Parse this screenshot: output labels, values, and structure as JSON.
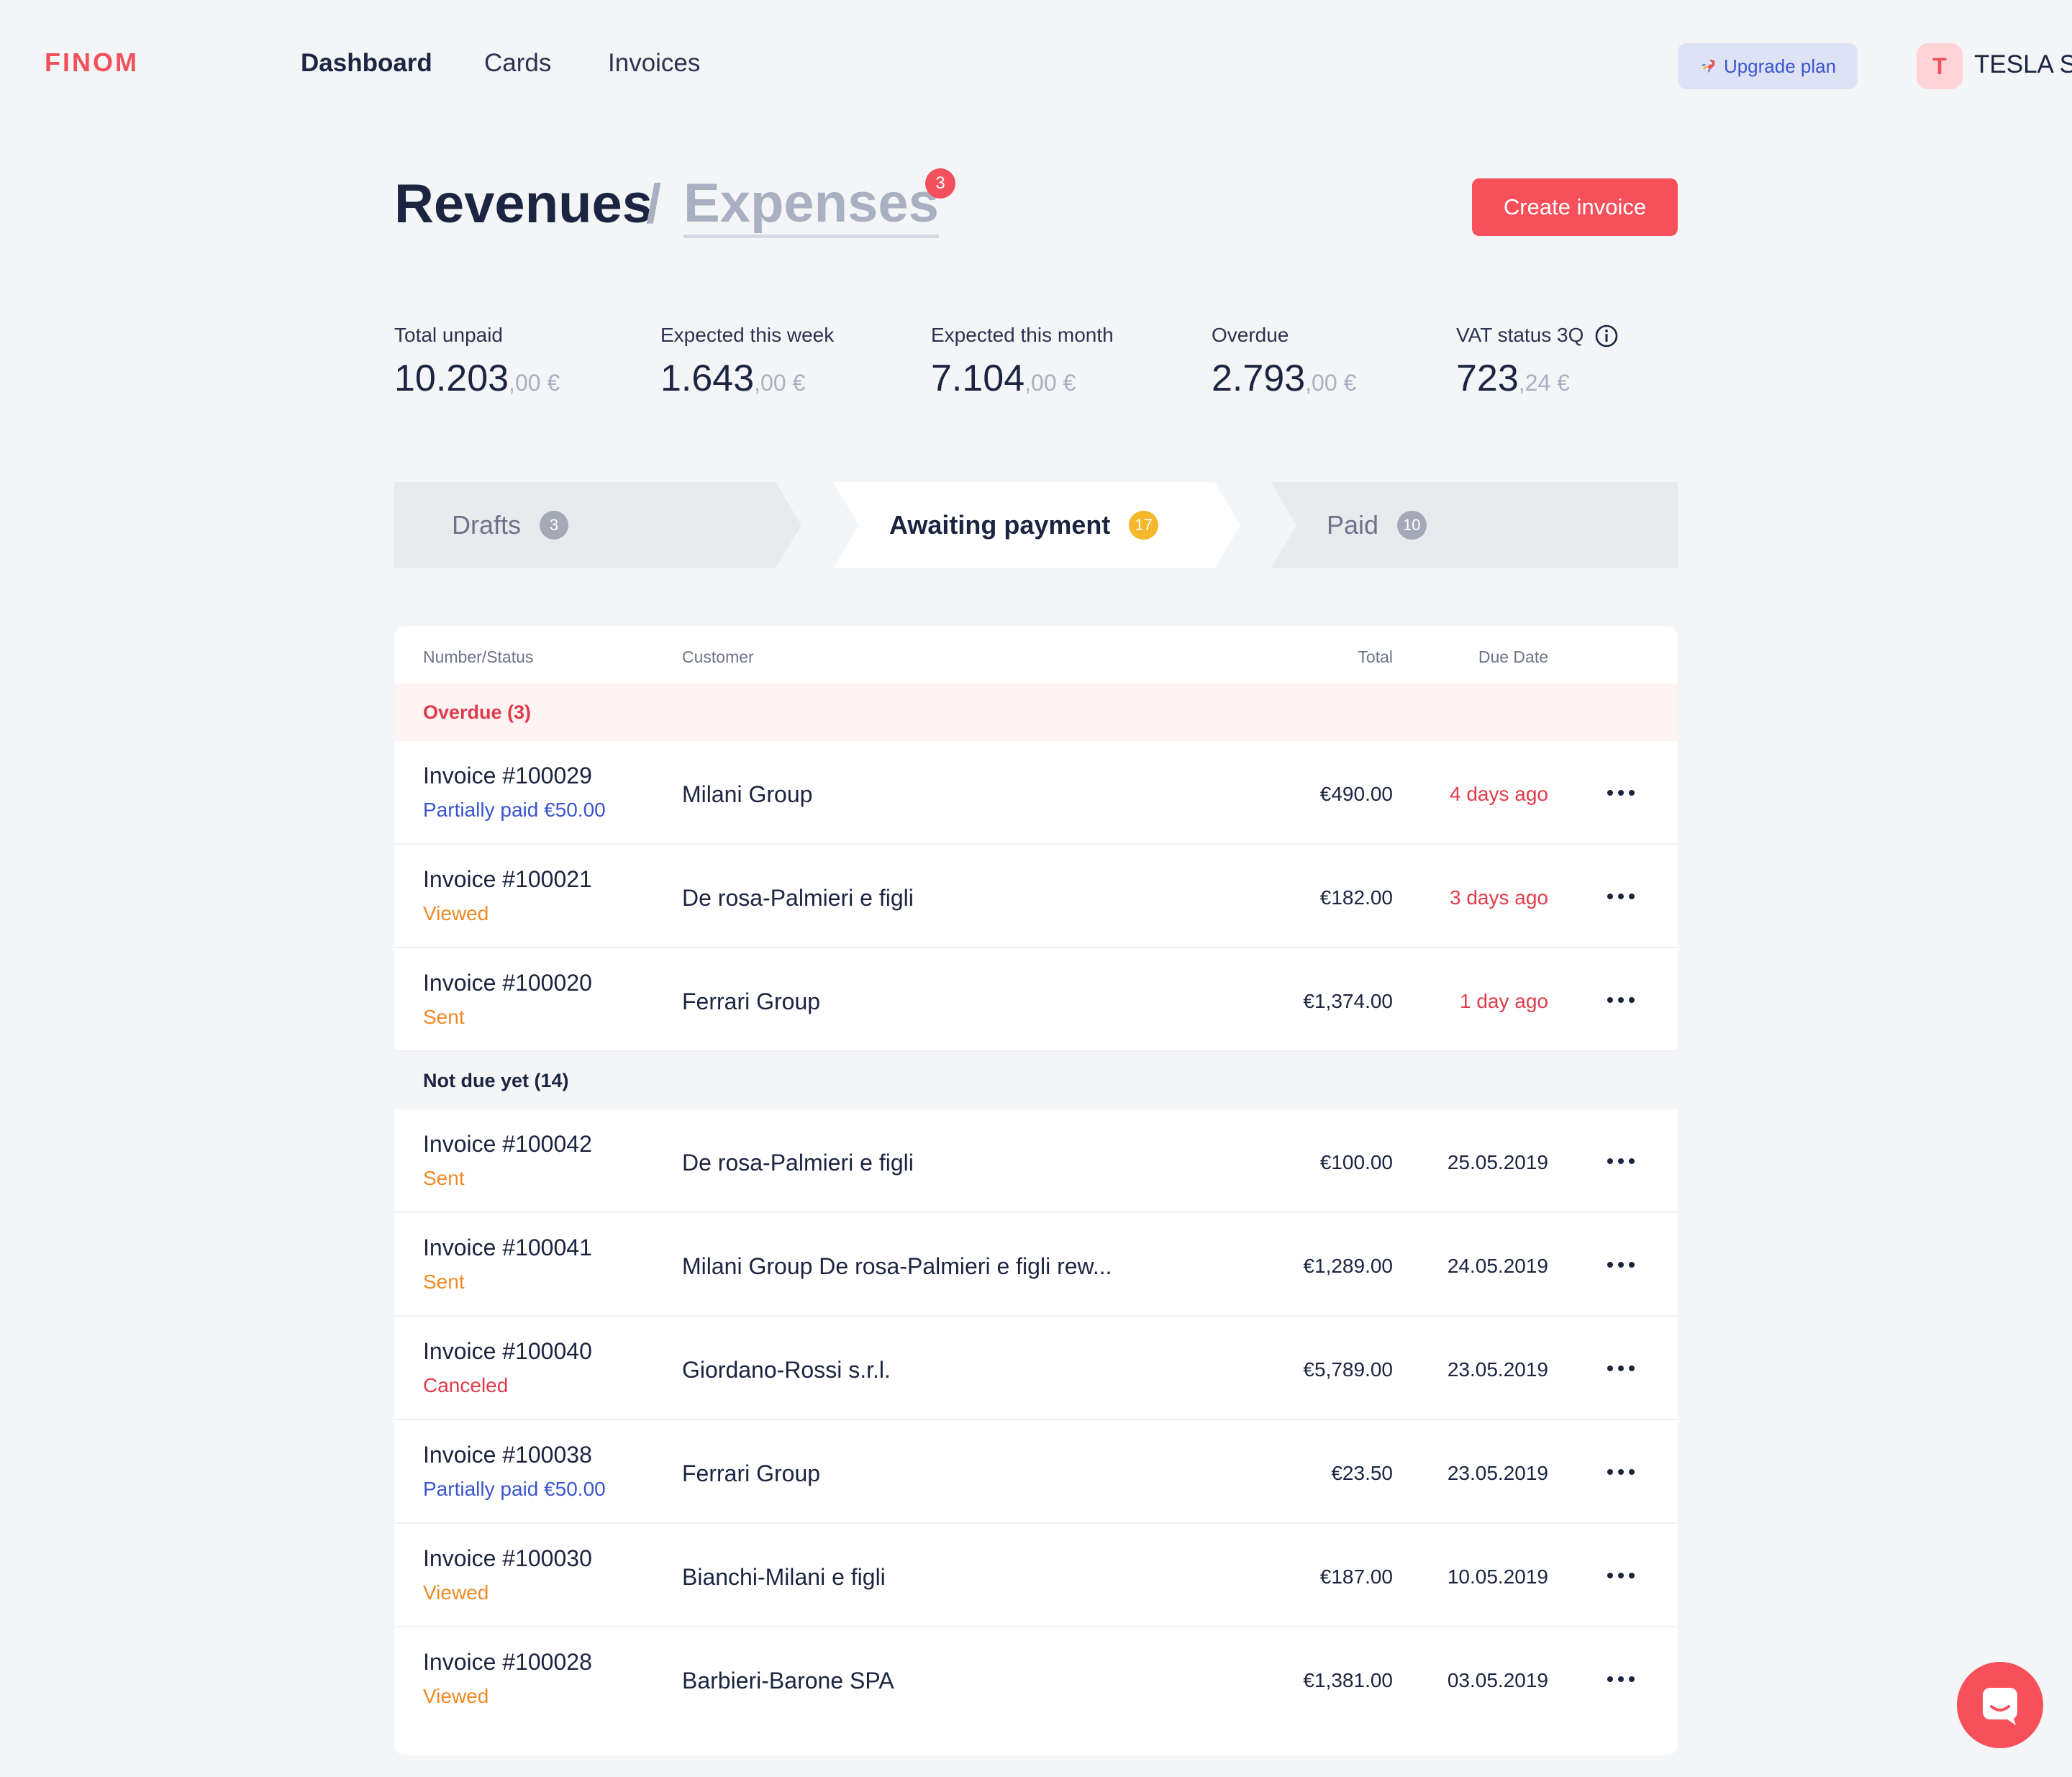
{
  "brand": {
    "logo": "FINOM",
    "accent": "#f2505d"
  },
  "nav": {
    "items": [
      {
        "label": "Dashboard",
        "active": true
      },
      {
        "label": "Cards",
        "active": false
      },
      {
        "label": "Invoices",
        "active": false
      }
    ],
    "upgrade_label": "Upgrade plan",
    "upgrade_icon": "rocket-icon",
    "avatar_letter": "T",
    "company_name": "TESLA S."
  },
  "heading": {
    "revenues": "Revenues",
    "slash": "/",
    "expenses": "Expenses",
    "expenses_badge": "3",
    "create_button": "Create invoice"
  },
  "stats": [
    {
      "label": "Total unpaid",
      "whole": "10.203",
      "cents": ",00 €"
    },
    {
      "label": "Expected this week",
      "whole": "1.643",
      "cents": ",00 €"
    },
    {
      "label": "Expected this month",
      "whole": "7.104",
      "cents": ",00 €"
    },
    {
      "label": "Overdue",
      "whole": "2.793",
      "cents": ",00 €"
    },
    {
      "label": "VAT status 3Q",
      "whole": "723",
      "cents": ",24 €",
      "icon": "info-icon"
    }
  ],
  "tabs": [
    {
      "label": "Drafts",
      "count": "3",
      "active": false
    },
    {
      "label": "Awaiting payment",
      "count": "17",
      "active": true
    },
    {
      "label": "Paid",
      "count": "10",
      "active": false
    }
  ],
  "table": {
    "headers": {
      "number_status": "Number/Status",
      "customer": "Customer",
      "total": "Total",
      "due_date": "Due Date"
    },
    "groups": [
      {
        "label": "Overdue (3)",
        "rows": [
          {
            "number": "Invoice #100029",
            "status": "Partially paid €50.00",
            "status_kind": "blue",
            "customer": "Milani Group",
            "total": "€490.00",
            "due": "4 days ago",
            "due_overdue": true
          },
          {
            "number": "Invoice #100021",
            "status": "Viewed",
            "status_kind": "orange",
            "customer": "De rosa-Palmieri e figli",
            "total": "€182.00",
            "due": "3 days ago",
            "due_overdue": true
          },
          {
            "number": "Invoice #100020",
            "status": "Sent",
            "status_kind": "orange",
            "customer": "Ferrari Group",
            "total": "€1,374.00",
            "due": "1 day ago",
            "due_overdue": true
          }
        ]
      },
      {
        "label": "Not due yet (14)",
        "rows": [
          {
            "number": "Invoice #100042",
            "status": "Sent",
            "status_kind": "orange",
            "customer": "De rosa-Palmieri e figli",
            "total": "€100.00",
            "due": "25.05.2019",
            "due_overdue": false
          },
          {
            "number": "Invoice #100041",
            "status": "Sent",
            "status_kind": "orange",
            "customer": "Milani Group De rosa-Palmieri e figli rew...",
            "total": "€1,289.00",
            "due": "24.05.2019",
            "due_overdue": false
          },
          {
            "number": "Invoice #100040",
            "status": "Canceled",
            "status_kind": "red",
            "customer": "Giordano-Rossi s.r.l.",
            "total": "€5,789.00",
            "due": "23.05.2019",
            "due_overdue": false
          },
          {
            "number": "Invoice #100038",
            "status": "Partially paid €50.00",
            "status_kind": "blue",
            "customer": "Ferrari Group",
            "total": "€23.50",
            "due": "23.05.2019",
            "due_overdue": false
          },
          {
            "number": "Invoice #100030",
            "status": "Viewed",
            "status_kind": "orange",
            "customer": "Bianchi-Milani e figli",
            "total": "€187.00",
            "due": "10.05.2019",
            "due_overdue": false
          },
          {
            "number": "Invoice #100028",
            "status": "Viewed",
            "status_kind": "orange",
            "customer": "Barbieri-Barone SPA",
            "total": "€1,381.00",
            "due": "03.05.2019",
            "due_overdue": false
          }
        ]
      }
    ]
  },
  "chat_icon": "chat-icon"
}
